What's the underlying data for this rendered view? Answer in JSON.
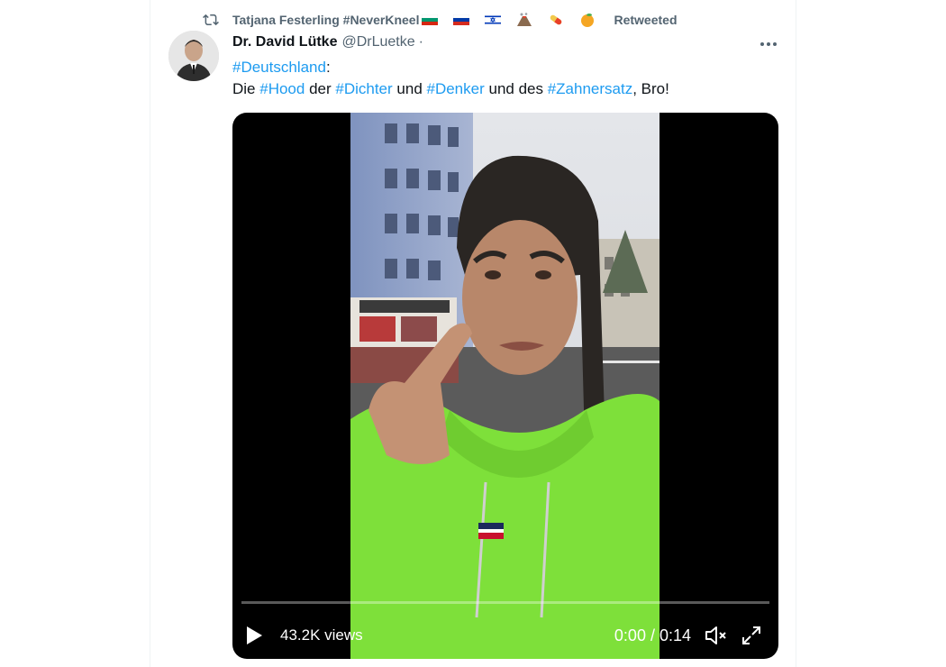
{
  "retweet": {
    "user": "Tatjana Festerling #NeverKneel",
    "label": "Retweeted",
    "icon": "retweet-icon"
  },
  "author": {
    "name": "Dr. David Lütke",
    "handle": "@DrLuetke",
    "separator": "·"
  },
  "tweet": {
    "line1": {
      "tag1": "#Deutschland",
      "rest": ":"
    },
    "line2": {
      "t0": "Die ",
      "tag_hood": "#Hood",
      "t1": " der ",
      "tag_dichter": "#Dichter",
      "t2": " und ",
      "tag_denker": "#Denker",
      "t3": " und des ",
      "tag_zahnersatz": "#Zahnersatz",
      "t4": ", Bro!"
    }
  },
  "video": {
    "views": "43.2K views",
    "time": "0:00 / 0:14",
    "progress": 0.0,
    "icons": [
      "play-icon",
      "volume-muted-icon",
      "fullscreen-icon"
    ]
  },
  "colors": {
    "link": "#1d9bf0",
    "secondary_text": "#536471",
    "primary_text": "#0f1419",
    "hoodie_green": "#7ee03a"
  }
}
